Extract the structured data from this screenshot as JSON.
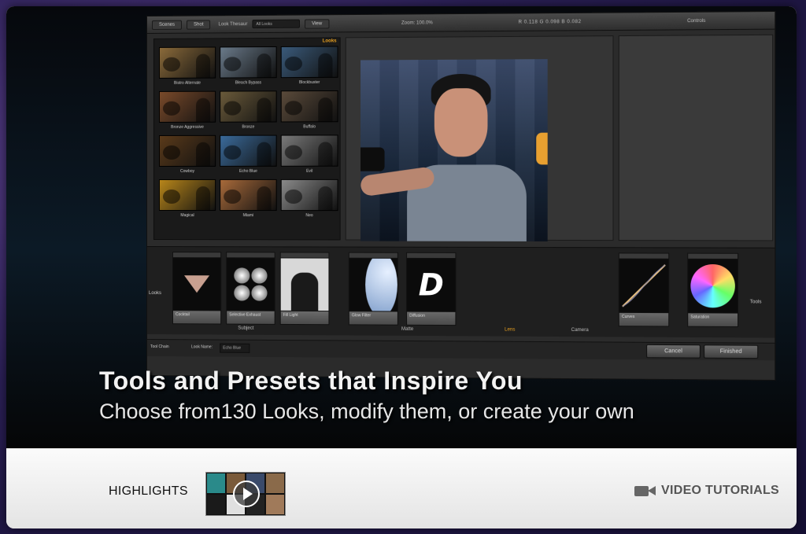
{
  "app": {
    "toolbar": {
      "scenes": "Scenes",
      "shots": "Shot",
      "look_thesaurus": "Look Thesaur",
      "looks_select": "All Looks",
      "view": "View",
      "zoom": "Zoom: 100.0%",
      "rgb": "R 0.118  G 0.098  B 0.082",
      "controls": "Controls"
    },
    "looks_panel": {
      "header": "Looks",
      "items": [
        {
          "label": "Bistro Alternate",
          "tint": "#8a6a3a"
        },
        {
          "label": "Bleach Bypass",
          "tint": "#6a7a8a"
        },
        {
          "label": "Blockbuster",
          "tint": "#3a5a7a"
        },
        {
          "label": "Bronze Aggressive",
          "tint": "#7a4a2a"
        },
        {
          "label": "Bronze",
          "tint": "#6a5a3a"
        },
        {
          "label": "Buffalo",
          "tint": "#5a4a3a"
        },
        {
          "label": "Cowboy",
          "tint": "#5a3a1a"
        },
        {
          "label": "Echo Blue",
          "tint": "#3a6a9a"
        },
        {
          "label": "Evil",
          "tint": "#7a7a7a"
        },
        {
          "label": "Magical",
          "tint": "#b8861a"
        },
        {
          "label": "Miami",
          "tint": "#a86a3a"
        },
        {
          "label": "Neo",
          "tint": "#8a8a8a"
        }
      ]
    },
    "tools": [
      {
        "label": "Cocktail"
      },
      {
        "label": "Selective Exhaust"
      },
      {
        "label": "Fill Light"
      },
      {
        "label": "Glow Filter"
      },
      {
        "label": "Diffusion"
      },
      {
        "label": "Curves"
      },
      {
        "label": "Saturation"
      }
    ],
    "groups": {
      "looks": "Looks",
      "subject": "Subject",
      "matte": "Matte",
      "lens": "Lens",
      "camera": "Camera",
      "tools": "Tools"
    },
    "footer": {
      "tool_chain": "Tool Chain",
      "look_name_label": "Look Name:",
      "look_name_value": "Echo Blue",
      "cancel": "Cancel",
      "finished": "Finished"
    }
  },
  "headline": "Tools and Presets that Inspire You",
  "subline": "Choose from130 Looks, modify them, or create your own",
  "bottom": {
    "highlights": "HIGHLIGHTS",
    "video_tutorials": "VIDEO TUTORIALS"
  }
}
